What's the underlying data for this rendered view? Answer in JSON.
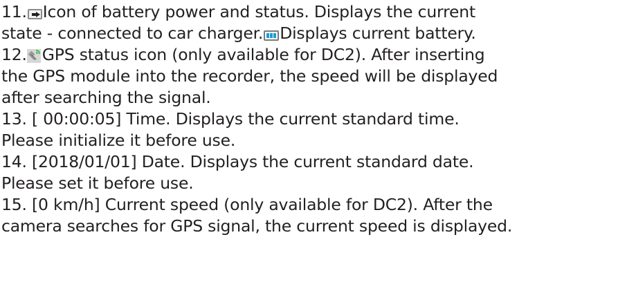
{
  "lines": [
    {
      "prefix": "11.",
      "suffix": "Icon of battery power and status. Displays the current"
    },
    {
      "before_icon": "state - connected to car charger.",
      "after_icon": "Displays current battery."
    },
    {
      "prefix": "12.",
      "suffix": "GPS status icon (only available for DC2). After inserting"
    },
    {
      "text": "the GPS module into the recorder, the speed will be displayed"
    },
    {
      "text": "after searching the signal."
    },
    {
      "text": "13. [ 00:00:05] Time. Displays the current standard time."
    },
    {
      "text": "Please initialize it before use."
    },
    {
      "text": "14. [2018/01/01] Date. Displays the current standard date."
    },
    {
      "text": "Please set it before use."
    },
    {
      "text": "15. [0 km/h] Current speed (only available for DC2). After the"
    },
    {
      "text": "camera searches for GPS signal, the current speed is displayed."
    }
  ],
  "icons": {
    "charger": "car-charger-battery-icon",
    "battery": "battery-level-icon",
    "gps": "gps-satellite-icon"
  },
  "colors": {
    "text": "#231f20",
    "battery_fill": "#1a9fd6",
    "gps_signal": "#3cc35a"
  }
}
